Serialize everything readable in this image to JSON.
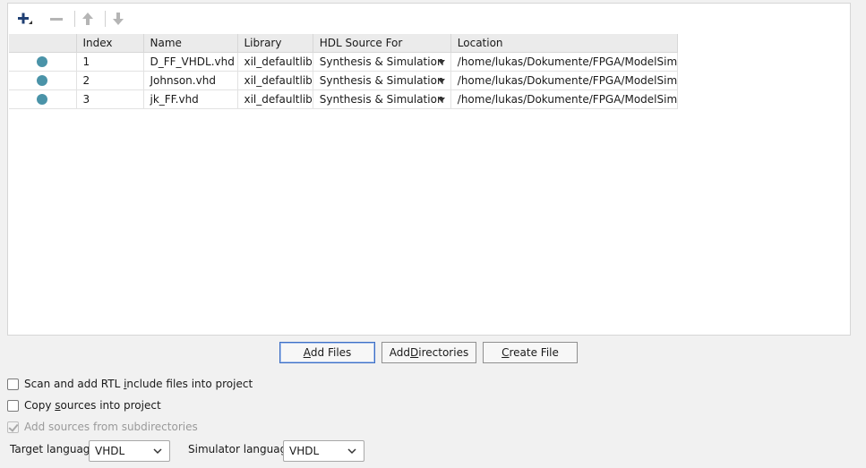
{
  "toolbar": {
    "add_icon": "plus-icon",
    "remove_icon": "minus-icon",
    "up_icon": "arrow-up-icon",
    "down_icon": "arrow-down-icon"
  },
  "table": {
    "columns": [
      "",
      "Index",
      "Name",
      "Library",
      "HDL Source For",
      "Location"
    ],
    "rows": [
      {
        "status": "status-dot-icon",
        "index": "1",
        "name": "D_FF_VHDL.vhd",
        "library": "xil_defaultlib",
        "hdl": "Synthesis & Simulation",
        "location": "/home/lukas/Dokumente/FPGA/ModelSim"
      },
      {
        "status": "status-dot-icon",
        "index": "2",
        "name": "Johnson.vhd",
        "library": "xil_defaultlib",
        "hdl": "Synthesis & Simulation",
        "location": "/home/lukas/Dokumente/FPGA/ModelSim"
      },
      {
        "status": "status-dot-icon",
        "index": "3",
        "name": "jk_FF.vhd",
        "library": "xil_defaultlib",
        "hdl": "Synthesis & Simulation",
        "location": "/home/lukas/Dokumente/FPGA/ModelSim"
      }
    ]
  },
  "buttons": {
    "add_files_u": "A",
    "add_files_rest": "dd Files",
    "add_dirs_pre": "Add ",
    "add_dirs_u": "D",
    "add_dirs_rest": "irectories",
    "create_u": "C",
    "create_rest": "reate File"
  },
  "options": {
    "scan_pre": "Scan and add RTL ",
    "scan_u": "i",
    "scan_rest": "nclude files into project",
    "copy_pre": "Copy ",
    "copy_u": "s",
    "copy_rest": "ources into project",
    "subdirs": "Add sources from subdirectories",
    "scan_checked": false,
    "copy_checked": false,
    "subdirs_checked": true
  },
  "language": {
    "target_label": "Target language:",
    "target_value": "VHDL",
    "simulator_label": "Simulator language:",
    "simulator_value": "VHDL"
  },
  "colors": {
    "status_dot": "#4a93a8",
    "accent_border": "#3d6fc5"
  }
}
